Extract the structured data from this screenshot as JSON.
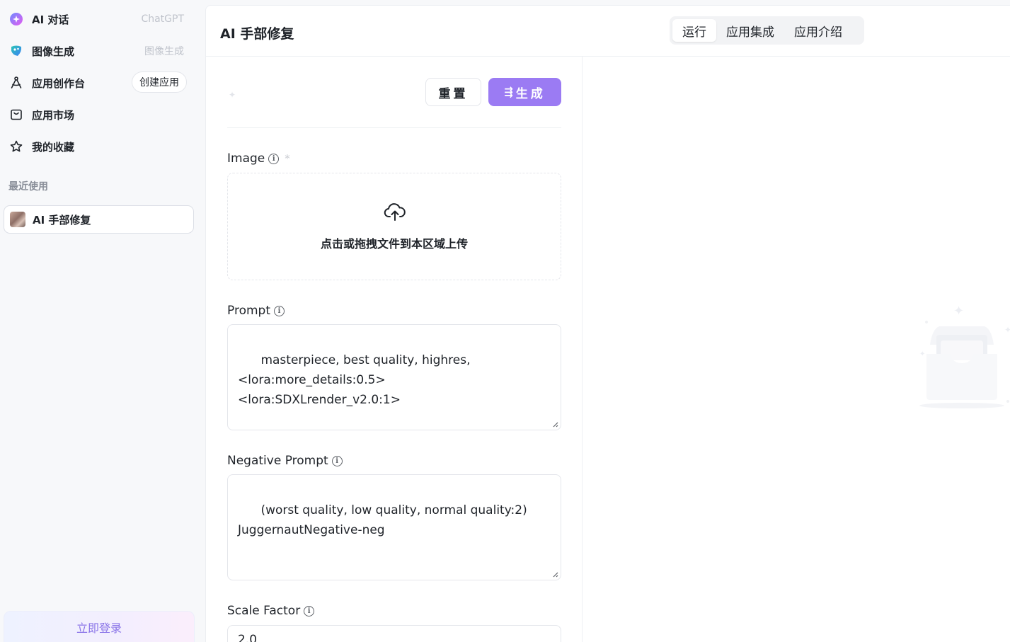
{
  "sidebar": {
    "items": [
      {
        "label": "AI 对话",
        "hint": "ChatGPT"
      },
      {
        "label": "图像生成",
        "hint": "图像生成"
      },
      {
        "label": "应用创作台",
        "action": "创建应用"
      },
      {
        "label": "应用市场"
      },
      {
        "label": "我的收藏"
      }
    ],
    "recent_label": "最近使用",
    "recent": [
      {
        "label": "AI 手部修复"
      }
    ],
    "login_label": "立即登录"
  },
  "header": {
    "title": "AI 手部修复",
    "tabs": [
      {
        "label": "运行",
        "active": true
      },
      {
        "label": "应用集成"
      },
      {
        "label": "应用介绍"
      }
    ]
  },
  "form": {
    "reset_label": "重置",
    "generate_label": "生成",
    "image": {
      "label": "Image",
      "required_mark": "*",
      "upload_text": "点击或拖拽文件到本区域上传"
    },
    "prompt": {
      "label": "Prompt",
      "value": "masterpiece, best quality, highres,\n<lora:more_details:0.5> <lora:SDXLrender_v2.0:1>"
    },
    "negative_prompt": {
      "label": "Negative Prompt",
      "value": "(worst quality, low quality, normal quality:2)\nJuggernautNegative-neg"
    },
    "scale_factor": {
      "label": "Scale Factor",
      "value": "2.0"
    }
  },
  "colors": {
    "accent": "#9b7bf3",
    "login_text": "#8a74e8"
  }
}
